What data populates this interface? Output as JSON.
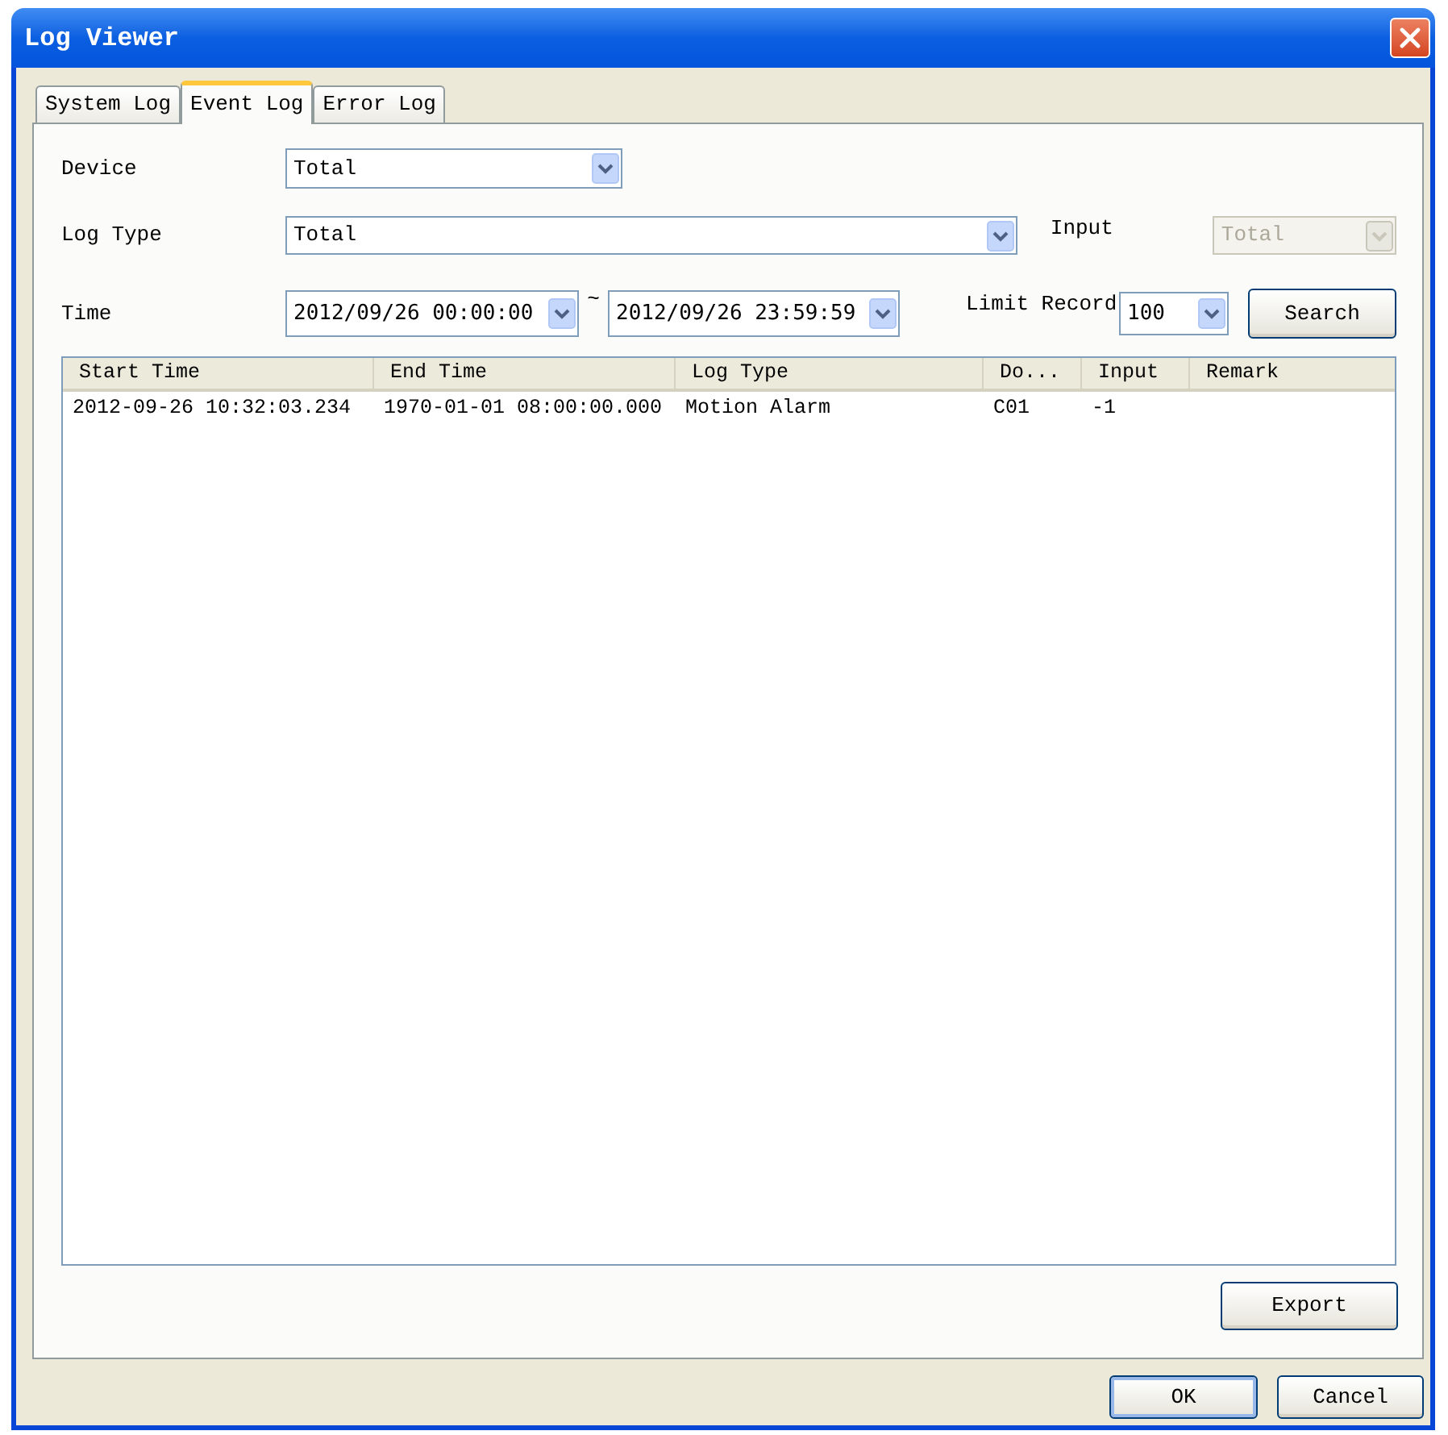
{
  "window": {
    "title": "Log Viewer"
  },
  "tabs": [
    {
      "label": "System Log",
      "selected": false
    },
    {
      "label": "Event Log",
      "selected": true
    },
    {
      "label": "Error Log",
      "selected": false
    }
  ],
  "device": {
    "label": "Device",
    "value": "Total",
    "disabled": false
  },
  "log_type": {
    "label": "Log Type",
    "value": "Total",
    "disabled": false
  },
  "input": {
    "label": "Input",
    "value": "Total",
    "disabled": true
  },
  "time": {
    "label": "Time",
    "start": {
      "value": "2012/09/26 00:00:00",
      "disabled": false
    },
    "separator": "~",
    "end": {
      "value": "2012/09/26 23:59:59",
      "disabled": false
    }
  },
  "limit_record": {
    "label": "Limit Record",
    "value": "100",
    "disabled": false
  },
  "search_button": {
    "label": "Search"
  },
  "table": {
    "columns": [
      "Start Time",
      "End Time",
      "Log Type",
      "Do...",
      "Input",
      "Remark"
    ],
    "rows": [
      {
        "cells": [
          "2012-09-26 10:32:03.234",
          "1970-01-01 08:00:00.000",
          "Motion Alarm",
          "C01",
          "-1"
        ]
      }
    ]
  },
  "export_button": {
    "label": "Export"
  },
  "footer_buttons": [
    {
      "label": "OK",
      "default": true
    },
    {
      "label": "Cancel",
      "default": false
    }
  ]
}
